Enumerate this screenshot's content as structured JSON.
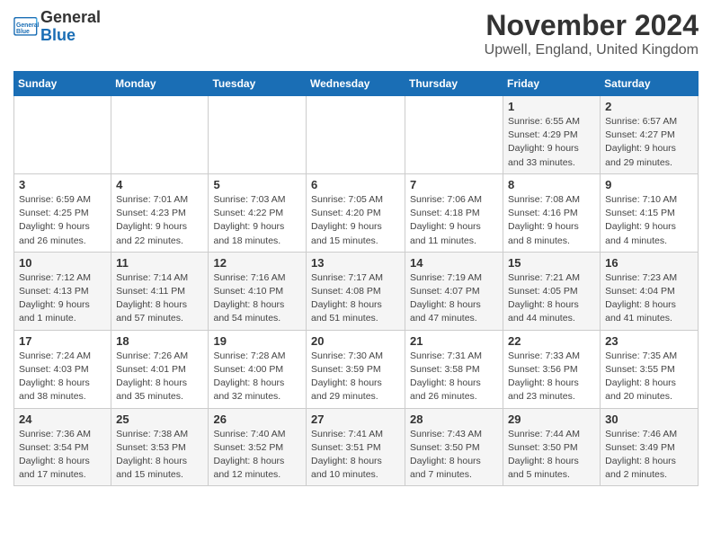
{
  "logo": {
    "line1": "General",
    "line2": "Blue"
  },
  "title": "November 2024",
  "location": "Upwell, England, United Kingdom",
  "headers": [
    "Sunday",
    "Monday",
    "Tuesday",
    "Wednesday",
    "Thursday",
    "Friday",
    "Saturday"
  ],
  "weeks": [
    [
      {
        "day": "",
        "info": ""
      },
      {
        "day": "",
        "info": ""
      },
      {
        "day": "",
        "info": ""
      },
      {
        "day": "",
        "info": ""
      },
      {
        "day": "",
        "info": ""
      },
      {
        "day": "1",
        "info": "Sunrise: 6:55 AM\nSunset: 4:29 PM\nDaylight: 9 hours and 33 minutes."
      },
      {
        "day": "2",
        "info": "Sunrise: 6:57 AM\nSunset: 4:27 PM\nDaylight: 9 hours and 29 minutes."
      }
    ],
    [
      {
        "day": "3",
        "info": "Sunrise: 6:59 AM\nSunset: 4:25 PM\nDaylight: 9 hours and 26 minutes."
      },
      {
        "day": "4",
        "info": "Sunrise: 7:01 AM\nSunset: 4:23 PM\nDaylight: 9 hours and 22 minutes."
      },
      {
        "day": "5",
        "info": "Sunrise: 7:03 AM\nSunset: 4:22 PM\nDaylight: 9 hours and 18 minutes."
      },
      {
        "day": "6",
        "info": "Sunrise: 7:05 AM\nSunset: 4:20 PM\nDaylight: 9 hours and 15 minutes."
      },
      {
        "day": "7",
        "info": "Sunrise: 7:06 AM\nSunset: 4:18 PM\nDaylight: 9 hours and 11 minutes."
      },
      {
        "day": "8",
        "info": "Sunrise: 7:08 AM\nSunset: 4:16 PM\nDaylight: 9 hours and 8 minutes."
      },
      {
        "day": "9",
        "info": "Sunrise: 7:10 AM\nSunset: 4:15 PM\nDaylight: 9 hours and 4 minutes."
      }
    ],
    [
      {
        "day": "10",
        "info": "Sunrise: 7:12 AM\nSunset: 4:13 PM\nDaylight: 9 hours and 1 minute."
      },
      {
        "day": "11",
        "info": "Sunrise: 7:14 AM\nSunset: 4:11 PM\nDaylight: 8 hours and 57 minutes."
      },
      {
        "day": "12",
        "info": "Sunrise: 7:16 AM\nSunset: 4:10 PM\nDaylight: 8 hours and 54 minutes."
      },
      {
        "day": "13",
        "info": "Sunrise: 7:17 AM\nSunset: 4:08 PM\nDaylight: 8 hours and 51 minutes."
      },
      {
        "day": "14",
        "info": "Sunrise: 7:19 AM\nSunset: 4:07 PM\nDaylight: 8 hours and 47 minutes."
      },
      {
        "day": "15",
        "info": "Sunrise: 7:21 AM\nSunset: 4:05 PM\nDaylight: 8 hours and 44 minutes."
      },
      {
        "day": "16",
        "info": "Sunrise: 7:23 AM\nSunset: 4:04 PM\nDaylight: 8 hours and 41 minutes."
      }
    ],
    [
      {
        "day": "17",
        "info": "Sunrise: 7:24 AM\nSunset: 4:03 PM\nDaylight: 8 hours and 38 minutes."
      },
      {
        "day": "18",
        "info": "Sunrise: 7:26 AM\nSunset: 4:01 PM\nDaylight: 8 hours and 35 minutes."
      },
      {
        "day": "19",
        "info": "Sunrise: 7:28 AM\nSunset: 4:00 PM\nDaylight: 8 hours and 32 minutes."
      },
      {
        "day": "20",
        "info": "Sunrise: 7:30 AM\nSunset: 3:59 PM\nDaylight: 8 hours and 29 minutes."
      },
      {
        "day": "21",
        "info": "Sunrise: 7:31 AM\nSunset: 3:58 PM\nDaylight: 8 hours and 26 minutes."
      },
      {
        "day": "22",
        "info": "Sunrise: 7:33 AM\nSunset: 3:56 PM\nDaylight: 8 hours and 23 minutes."
      },
      {
        "day": "23",
        "info": "Sunrise: 7:35 AM\nSunset: 3:55 PM\nDaylight: 8 hours and 20 minutes."
      }
    ],
    [
      {
        "day": "24",
        "info": "Sunrise: 7:36 AM\nSunset: 3:54 PM\nDaylight: 8 hours and 17 minutes."
      },
      {
        "day": "25",
        "info": "Sunrise: 7:38 AM\nSunset: 3:53 PM\nDaylight: 8 hours and 15 minutes."
      },
      {
        "day": "26",
        "info": "Sunrise: 7:40 AM\nSunset: 3:52 PM\nDaylight: 8 hours and 12 minutes."
      },
      {
        "day": "27",
        "info": "Sunrise: 7:41 AM\nSunset: 3:51 PM\nDaylight: 8 hours and 10 minutes."
      },
      {
        "day": "28",
        "info": "Sunrise: 7:43 AM\nSunset: 3:50 PM\nDaylight: 8 hours and 7 minutes."
      },
      {
        "day": "29",
        "info": "Sunrise: 7:44 AM\nSunset: 3:50 PM\nDaylight: 8 hours and 5 minutes."
      },
      {
        "day": "30",
        "info": "Sunrise: 7:46 AM\nSunset: 3:49 PM\nDaylight: 8 hours and 2 minutes."
      }
    ]
  ]
}
